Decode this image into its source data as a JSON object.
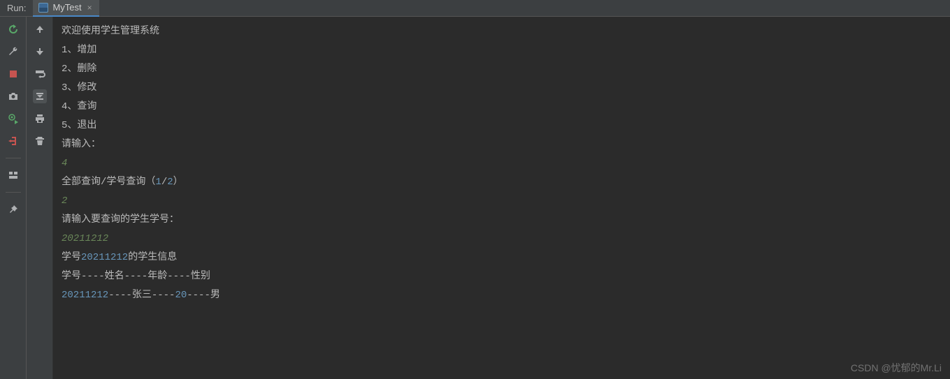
{
  "topbar": {
    "run_label": "Run:",
    "tab_title": "MyTest",
    "tab_close": "×"
  },
  "console": {
    "lines": [
      {
        "type": "out",
        "text": "欢迎使用学生管理系统"
      },
      {
        "type": "out",
        "text": "1、增加"
      },
      {
        "type": "out",
        "text": "2、删除"
      },
      {
        "type": "out",
        "text": "3、修改"
      },
      {
        "type": "out",
        "text": "4、查询"
      },
      {
        "type": "out",
        "text": "5、退出"
      },
      {
        "type": "out",
        "text": "请输入："
      },
      {
        "type": "in",
        "text": "4"
      },
      {
        "type": "out_num",
        "prefix": "全部查询/学号查询（",
        "num1": "1",
        "mid": "/",
        "num2": "2",
        "suffix": "）"
      },
      {
        "type": "in",
        "text": "2"
      },
      {
        "type": "out",
        "text": "请输入要查询的学生学号："
      },
      {
        "type": "in",
        "text": "20211212"
      },
      {
        "type": "out_num2",
        "prefix": "学号",
        "num": "20211212",
        "suffix": "的学生信息"
      },
      {
        "type": "out",
        "text": "学号----姓名----年龄----性别"
      },
      {
        "type": "out_num3",
        "num1": "20211212",
        "t1": "----张三----",
        "num2": "20",
        "t2": "----男"
      }
    ]
  },
  "watermark": "CSDN @忧郁的Mr.Li"
}
